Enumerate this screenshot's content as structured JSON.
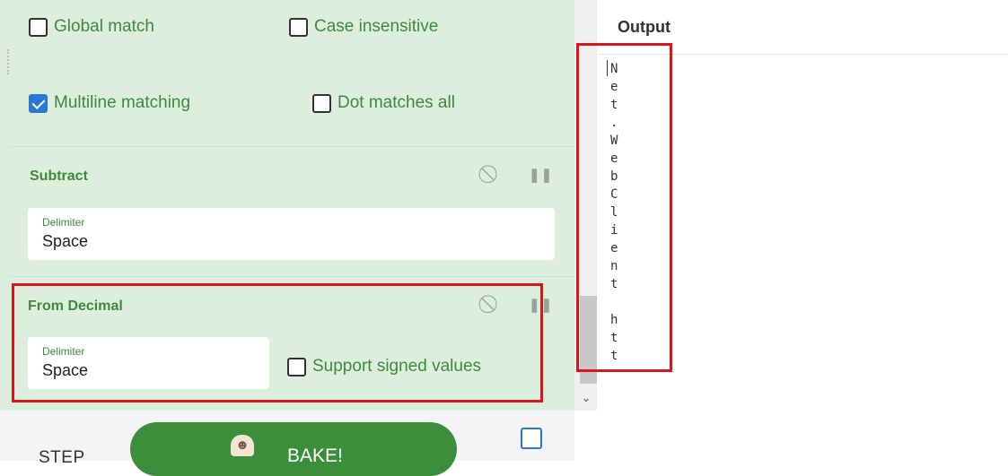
{
  "regex_options": {
    "global_match": {
      "label": "Global match",
      "checked": false
    },
    "case_insensitive": {
      "label": "Case insensitive",
      "checked": false
    },
    "multiline_matching": {
      "label": "Multiline matching",
      "checked": true
    },
    "dot_matches_all": {
      "label": "Dot matches all",
      "checked": false
    }
  },
  "subtract": {
    "title": "Subtract",
    "delimiter_label": "Delimiter",
    "delimiter_value": "Space"
  },
  "from_decimal": {
    "title": "From Decimal",
    "delimiter_label": "Delimiter",
    "delimiter_value": "Space",
    "support_signed": {
      "label": "Support signed values",
      "checked": false
    }
  },
  "icons": {
    "disable": "disable-icon",
    "pause": "pause-icon",
    "scroll_down": "chevron-down-icon",
    "chef": "chef-icon"
  },
  "controls": {
    "step_label": "STEP",
    "bake_label": "BAKE!",
    "auto_bake_checked": false
  },
  "output": {
    "title": "Output",
    "text": "N\ne\nt\n.\nW\ne\nb\nC\nl\ni\ne\nn\nt\n\nh\nt\nt"
  },
  "colors": {
    "recipe_background": "#ddeedd",
    "accent_green": "#3d8a3d",
    "bake_button": "#3b8f3b",
    "checkbox_blue": "#2b78d4",
    "highlight_red": "#d9161c"
  }
}
